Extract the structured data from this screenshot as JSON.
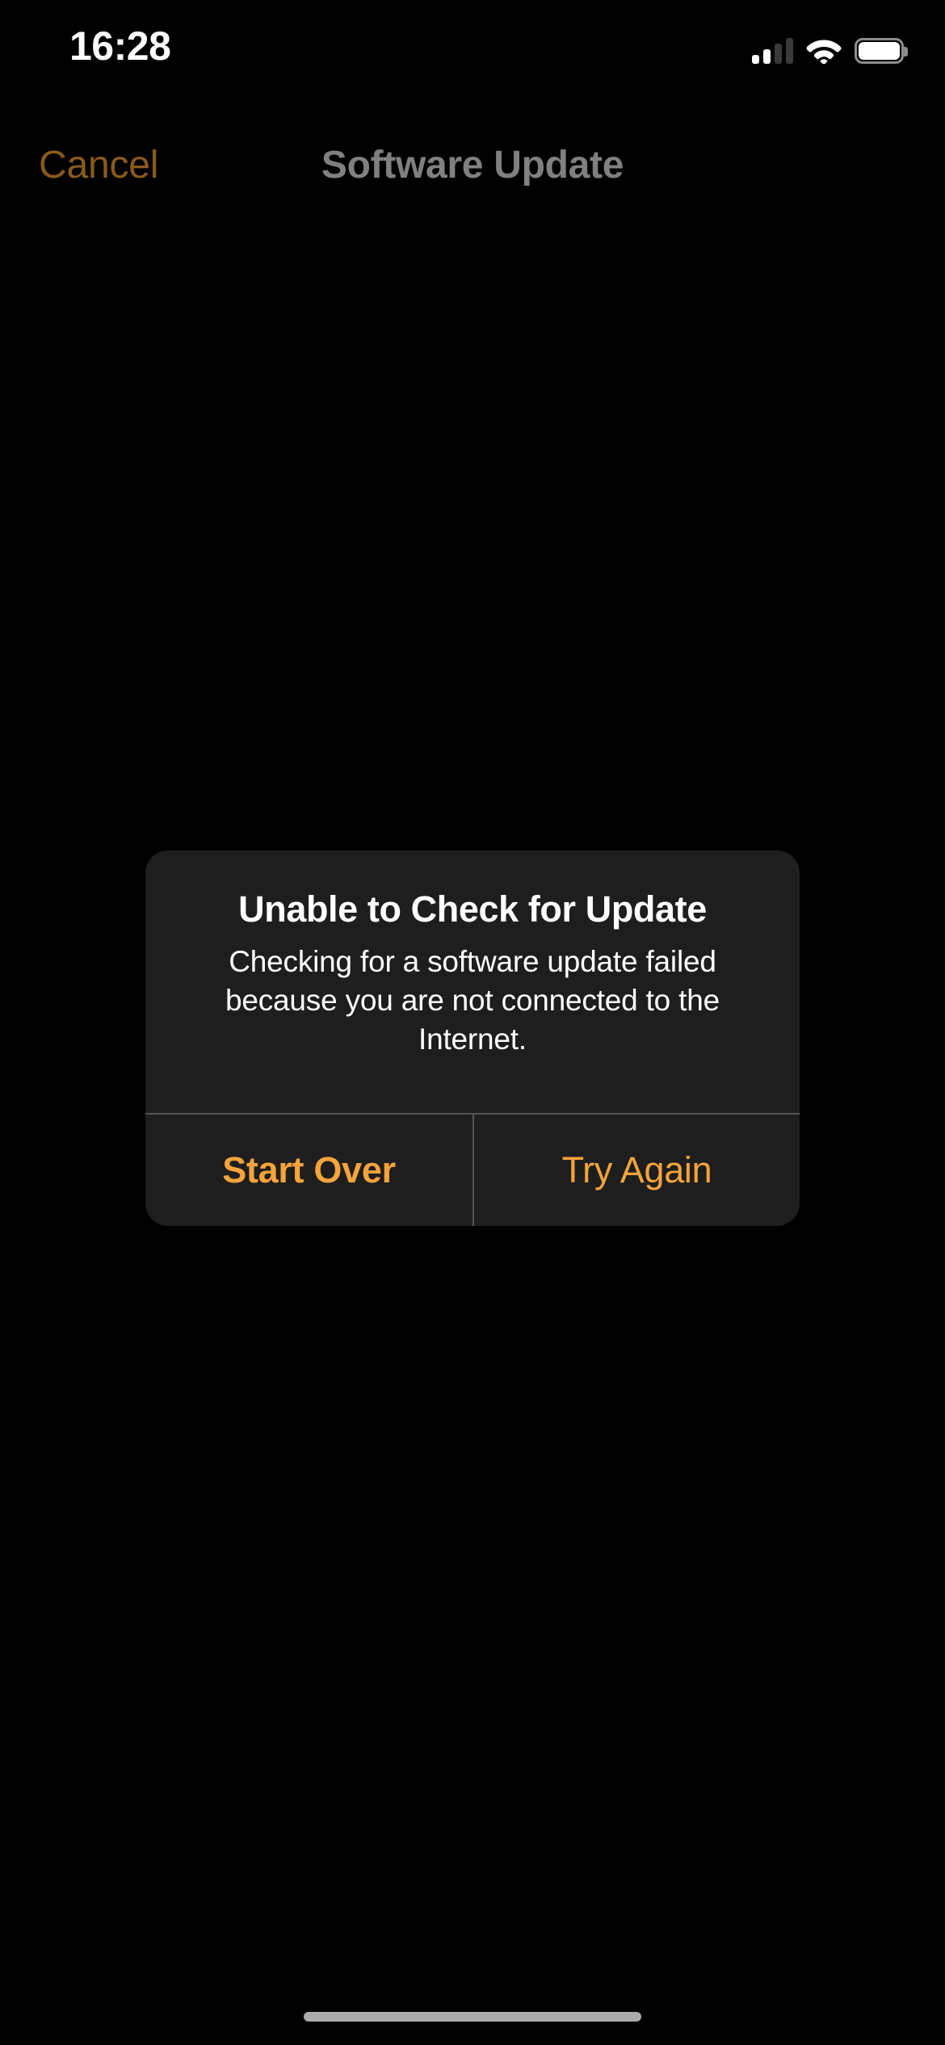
{
  "status_bar": {
    "time": "16:28",
    "cellular_icon": "cellular-signal-icon",
    "cellular_bars_total": 4,
    "cellular_bars_active": 2,
    "wifi_icon": "wifi-icon",
    "wifi_strength": "full",
    "battery_icon": "battery-icon",
    "battery_level_percent": 100
  },
  "nav_bar": {
    "cancel_label": "Cancel",
    "title": "Software Update"
  },
  "alert": {
    "title": "Unable to Check for Update",
    "message": "Checking for a software update failed because you are not connected to the Internet.",
    "buttons": [
      {
        "label": "Start Over",
        "emphasis": "bold"
      },
      {
        "label": "Try Again",
        "emphasis": "regular"
      }
    ]
  },
  "home_indicator": {
    "name": "home-indicator"
  },
  "colors": {
    "background": "#000000",
    "alert_background": "#1e1e1e",
    "alert_divider": "#545454",
    "accent_orange": "#F5A33C",
    "nav_cancel_dimmed": "#8a5a1c",
    "nav_title_gray": "#808080",
    "text_primary": "#ffffff",
    "home_indicator": "#ababab"
  }
}
